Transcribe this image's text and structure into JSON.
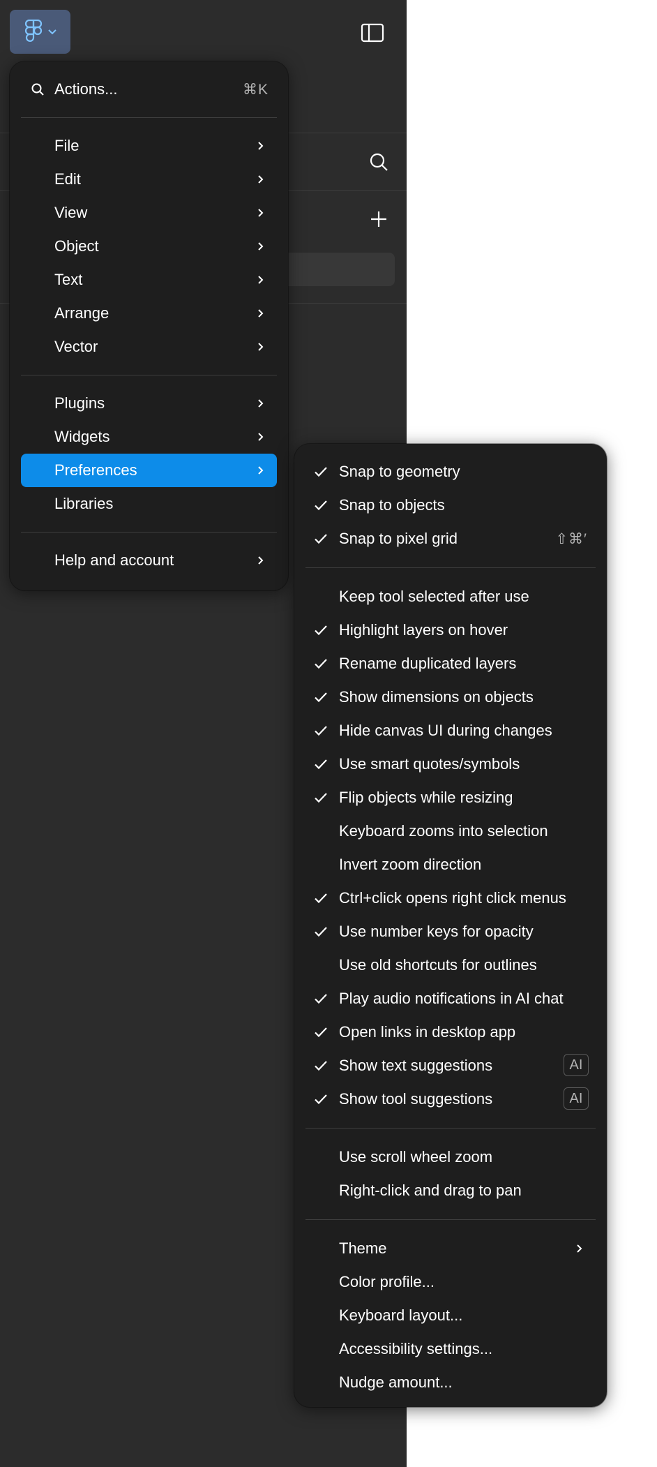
{
  "main_menu": {
    "search": {
      "label": "Actions...",
      "shortcut": "⌘K"
    },
    "groups": [
      [
        {
          "label": "File",
          "submenu": true
        },
        {
          "label": "Edit",
          "submenu": true
        },
        {
          "label": "View",
          "submenu": true
        },
        {
          "label": "Object",
          "submenu": true
        },
        {
          "label": "Text",
          "submenu": true
        },
        {
          "label": "Arrange",
          "submenu": true
        },
        {
          "label": "Vector",
          "submenu": true
        }
      ],
      [
        {
          "label": "Plugins",
          "submenu": true
        },
        {
          "label": "Widgets",
          "submenu": true
        },
        {
          "label": "Preferences",
          "submenu": true,
          "active": true
        },
        {
          "label": "Libraries",
          "submenu": false
        }
      ],
      [
        {
          "label": "Help and account",
          "submenu": true
        }
      ]
    ]
  },
  "preferences_menu": {
    "groups": [
      [
        {
          "label": "Snap to geometry",
          "checked": true
        },
        {
          "label": "Snap to objects",
          "checked": true
        },
        {
          "label": "Snap to pixel grid",
          "checked": true,
          "shortcut": "⇧⌘′"
        }
      ],
      [
        {
          "label": "Keep tool selected after use",
          "checked": false
        },
        {
          "label": "Highlight layers on hover",
          "checked": true
        },
        {
          "label": "Rename duplicated layers",
          "checked": true
        },
        {
          "label": "Show dimensions on objects",
          "checked": true
        },
        {
          "label": "Hide canvas UI during changes",
          "checked": true
        },
        {
          "label": "Use smart quotes/symbols",
          "checked": true
        },
        {
          "label": "Flip objects while resizing",
          "checked": true
        },
        {
          "label": "Keyboard zooms into selection",
          "checked": false
        },
        {
          "label": "Invert zoom direction",
          "checked": false
        },
        {
          "label": "Ctrl+click opens right click menus",
          "checked": true
        },
        {
          "label": "Use number keys for opacity",
          "checked": true
        },
        {
          "label": "Use old shortcuts for outlines",
          "checked": false
        },
        {
          "label": "Play audio notifications in AI chat",
          "checked": true
        },
        {
          "label": "Open links in desktop app",
          "checked": true
        },
        {
          "label": "Show text suggestions",
          "checked": true,
          "badge": "AI"
        },
        {
          "label": "Show tool suggestions",
          "checked": true,
          "badge": "AI"
        }
      ],
      [
        {
          "label": "Use scroll wheel zoom",
          "checked": false
        },
        {
          "label": "Right-click and drag to pan",
          "checked": false
        }
      ],
      [
        {
          "label": "Theme",
          "checked": false,
          "submenu": true
        },
        {
          "label": "Color profile...",
          "checked": false
        },
        {
          "label": "Keyboard layout...",
          "checked": false
        },
        {
          "label": "Accessibility settings...",
          "checked": false
        },
        {
          "label": "Nudge amount...",
          "checked": false
        }
      ]
    ]
  },
  "colors": {
    "panel_bg": "#2c2c2c",
    "menu_bg": "#1e1e1e",
    "accent": "#0d8ce9",
    "app_button_bg": "#4a5a78"
  },
  "icons": {
    "app_logo": "figma-logo-icon",
    "panel_toggle": "sidebar-toggle-icon",
    "search": "search-icon",
    "add": "plus-icon"
  }
}
